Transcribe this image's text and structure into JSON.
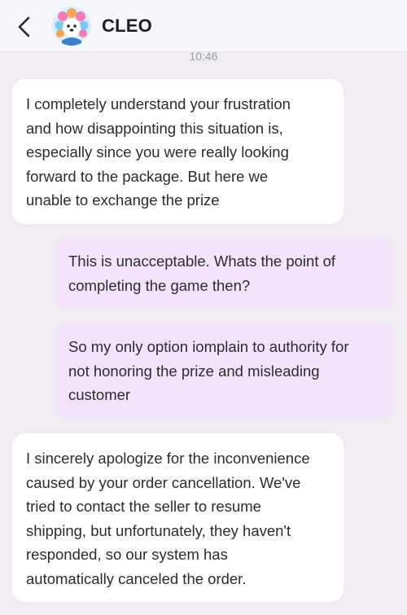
{
  "header": {
    "back_icon": "chevron-left-icon",
    "avatar_icon": "cartoon-avatar-icon",
    "contact_name": "CLEO"
  },
  "timestamp": "10:46",
  "colors": {
    "background": "#efedf1",
    "incoming_bubble": "#ffffff",
    "outgoing_bubble": "#f3e3fb",
    "text": "#2b2b30"
  },
  "messages": [
    {
      "direction": "incoming",
      "text": "I completely understand your frustration\nand how disappointing this situation is,\nespecially since you were really looking\nforward to the package. But here we\nunable to exchange the prize"
    },
    {
      "direction": "outgoing",
      "text": "This is unacceptable. Whats the point of\ncompleting the game then?"
    },
    {
      "direction": "outgoing",
      "text": "So my only option iomplain to authority for\nnot honoring the prize and misleading\ncustomer"
    },
    {
      "direction": "incoming",
      "text": "I sincerely apologize for the inconvenience\ncaused by your order cancellation. We've\ntried to contact the seller to resume\nshipping, but unfortunately, they haven't\nresponded, so our system has\nautomatically canceled the order."
    }
  ]
}
